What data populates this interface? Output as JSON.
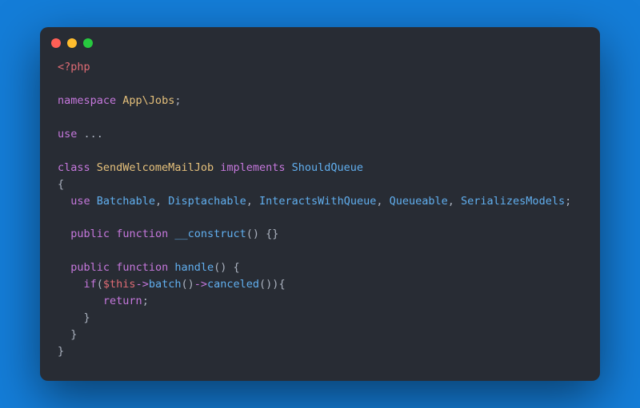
{
  "code": {
    "open_tag": "<?php",
    "ns_kw": "namespace",
    "ns_name": "App\\Jobs",
    "semi": ";",
    "use_kw": "use",
    "use_rest": "...",
    "class_kw": "class",
    "class_name": "SendWelcomeMailJob",
    "impl_kw": "implements",
    "iface": "ShouldQueue",
    "ob": "{",
    "cb": "}",
    "use2_kw": "use",
    "trait1": "Batchable",
    "trait2": "Disptachable",
    "trait3": "InteractsWithQueue",
    "trait4": "Queueable",
    "trait5": "SerializesModels",
    "public_kw": "public",
    "function_kw": "function",
    "ctor_name": "__construct",
    "parens": "()",
    "empty_body": "{}",
    "handle_name": "handle",
    "ob2": "{",
    "if_kw": "if",
    "op_paren": "(",
    "this_var": "$this",
    "arrow": "->",
    "batch_call": "batch",
    "parens2": "()",
    "canceled_call": "canceled",
    "parens3": "()",
    "cp_paren": ")",
    "ob3": "{",
    "return_kw": "return",
    "cb3": "}",
    "cb2": "}",
    "cb_outer": "}"
  }
}
